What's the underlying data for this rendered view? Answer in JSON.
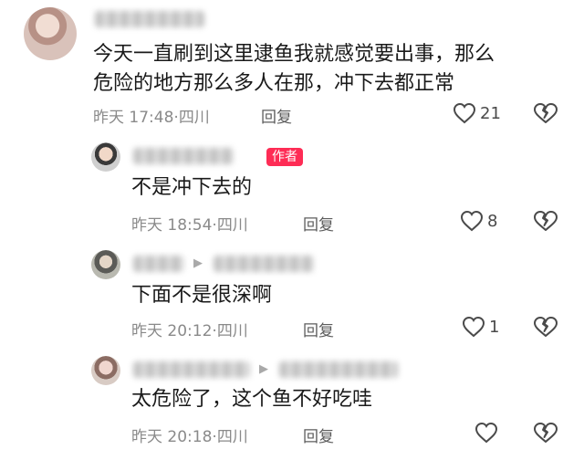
{
  "comments": [
    {
      "text_lines": [
        "今天一直刷到这里逮鱼我就感觉要出事，那么",
        "危险的地方那么多人在那，冲下去都正常"
      ],
      "time": "昨天 17:48",
      "location": "四川",
      "reply_label": "回复",
      "likes": "21"
    },
    {
      "author_badge": "作者",
      "text": "不是冲下去的",
      "time": "昨天 18:54",
      "location": "四川",
      "reply_label": "回复",
      "likes": "8"
    },
    {
      "text": "下面不是很深啊",
      "time": "昨天 20:12",
      "location": "四川",
      "reply_label": "回复",
      "likes": "1"
    },
    {
      "text": "太危险了，这个鱼不好吃哇",
      "time": "昨天 20:18",
      "location": "四川",
      "reply_label": "回复",
      "likes": ""
    }
  ],
  "separator": "·",
  "reply_arrow": "▶",
  "icons": {
    "like": "heart-outline-icon",
    "dislike": "broken-heart-icon"
  }
}
